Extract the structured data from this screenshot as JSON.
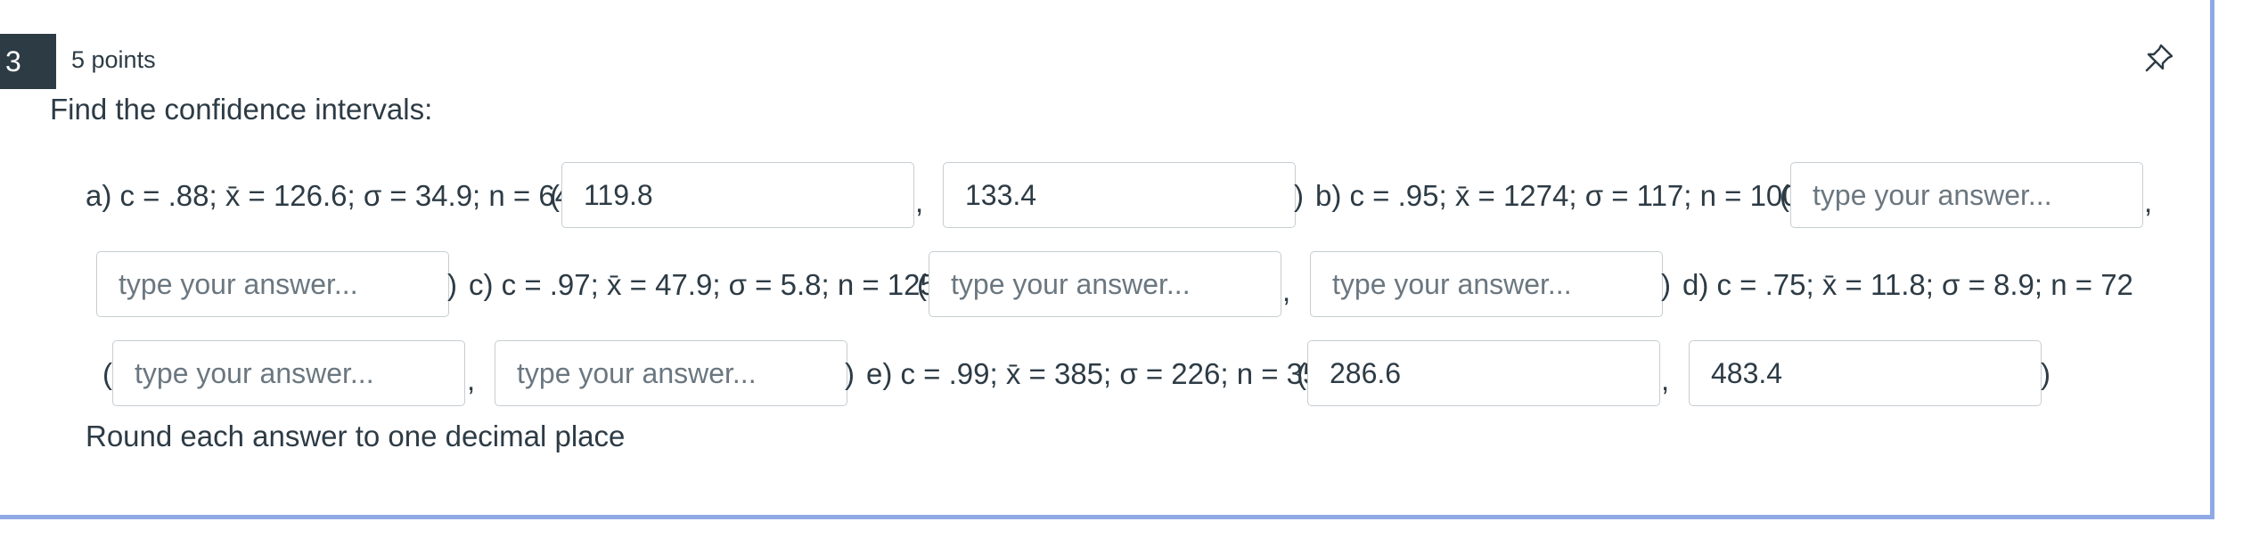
{
  "question": {
    "number": "3",
    "points": "5 points",
    "prompt": "Find the confidence intervals:",
    "footer": "Round each answer to one decimal place"
  },
  "icons": {
    "pin": "pin-icon"
  },
  "colors": {
    "number_badge_bg": "#2d3b45",
    "card_border": "#8fa8e6",
    "input_border": "#c7cdd1",
    "placeholder_text": "#6b7780"
  },
  "parts": {
    "a": {
      "label": "a) c = .88; x̄ = 126.6; σ = 34.9; n = 64"
    },
    "b": {
      "label": "b) c = .95; x̄ = 1274; σ = 117; n = 100"
    },
    "c": {
      "label": "c) c = .97; x̄ = 47.9; σ = 5.8; n = 125"
    },
    "d": {
      "label": "d) c = .75; x̄ = 11.8; σ = 8.9; n = 72"
    },
    "e": {
      "label": "e) c = .99; x̄ = 385; σ = 226; n = 35"
    }
  },
  "punct": {
    "open": "(",
    "close": ")",
    "comma": ","
  },
  "answers": {
    "placeholder": "type your answer...",
    "a_lower": "119.8",
    "a_upper": "133.4",
    "b_lower": "",
    "b_upper": "",
    "c_lower": "",
    "c_upper": "",
    "d_lower": "",
    "d_upper": "",
    "e_lower": "286.6",
    "e_upper": "483.4"
  }
}
